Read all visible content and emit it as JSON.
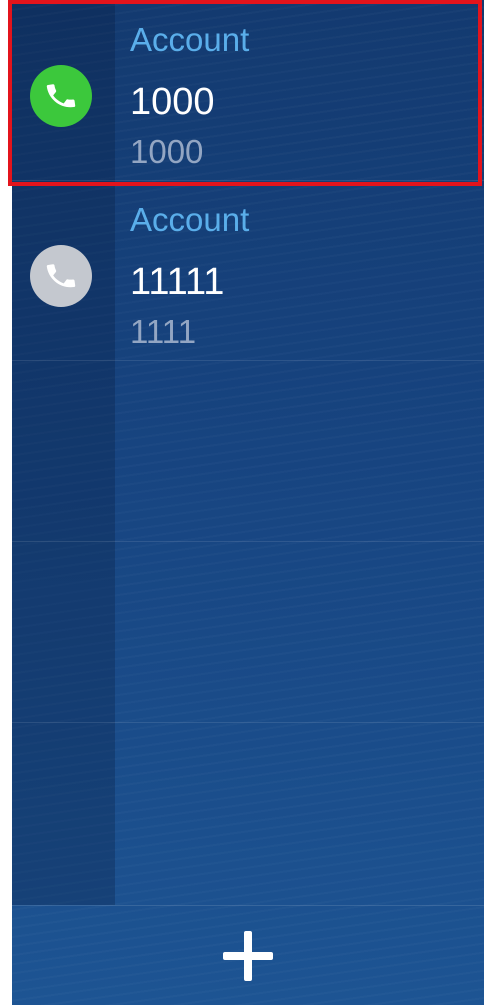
{
  "accounts": [
    {
      "label": "Account",
      "name": "1000",
      "number": "1000",
      "status": "registered",
      "icon": "phone-icon",
      "icon_color": "#3cc83c"
    },
    {
      "label": "Account",
      "name": "11111",
      "number": "1111",
      "status": "unregistered",
      "icon": "phone-icon",
      "icon_color": "#c4c8cf"
    }
  ],
  "highlight_color": "#e3141c",
  "bottom_bar": {
    "add_icon": "plus-icon"
  }
}
